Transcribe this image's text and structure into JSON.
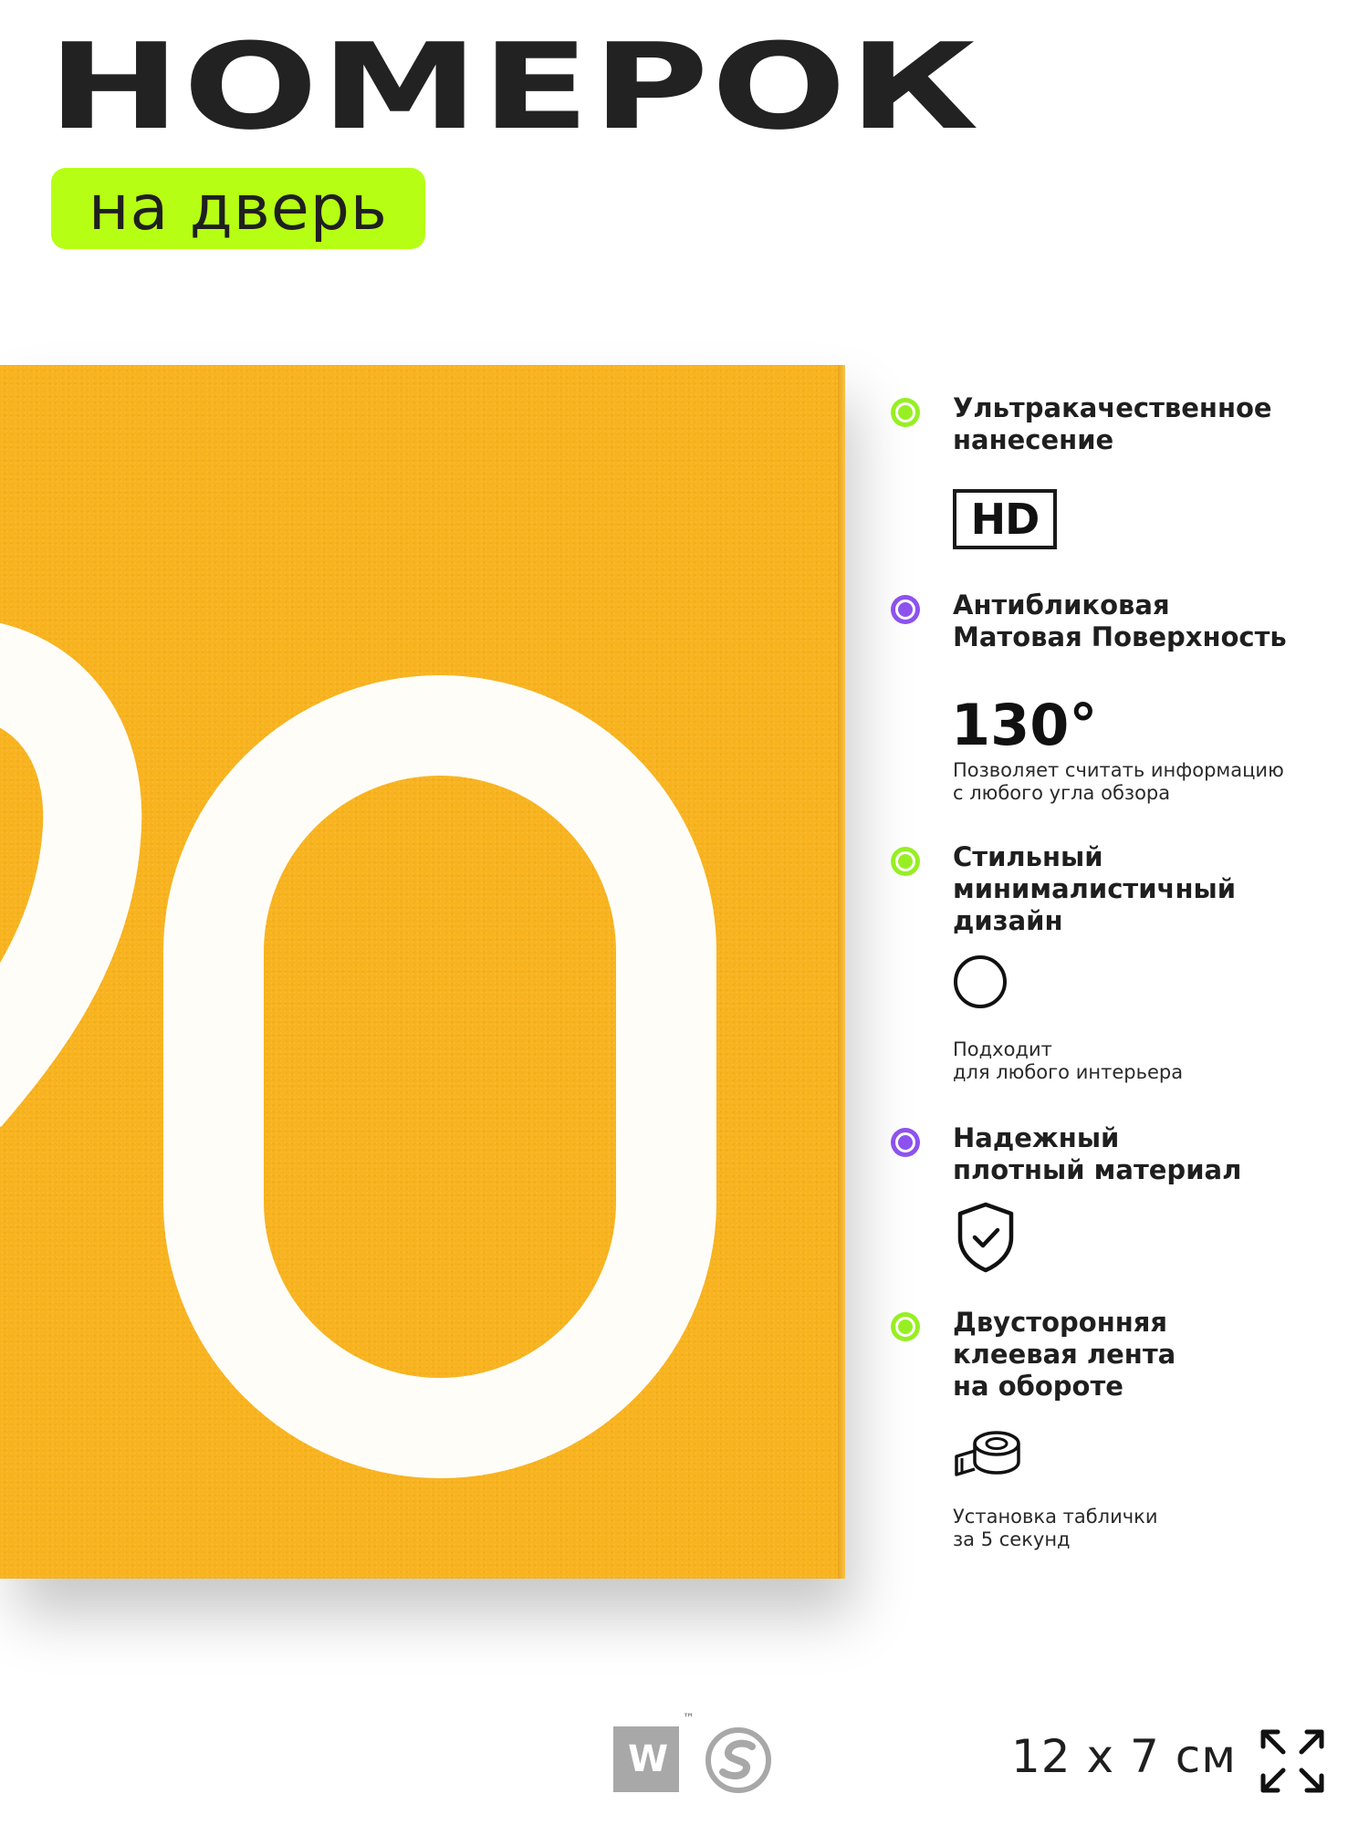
{
  "header": {
    "title": "НОМЕРОК",
    "subtitle": "на дверь"
  },
  "plate": {
    "color": "#f8b31e",
    "digit_color": "#ffffff"
  },
  "features": [
    {
      "dot_color": "#97ef23",
      "title": "Ультракачественное\nнанесение",
      "badge": "HD"
    },
    {
      "dot_color": "#8d52ee",
      "title": "Антибликовая\nМатовая Поверхность",
      "value": "130°",
      "note": "Позволяет считать информацию\nс любого угла обзора"
    },
    {
      "dot_color": "#97ef23",
      "title": "Стильный\nминималистичный\nдизайн",
      "icon": "circle-icon",
      "note": "Подходит\nдля любого интерьера"
    },
    {
      "dot_color": "#8d52ee",
      "title": "Надежный\nплотный материал",
      "icon": "shield-check-icon"
    },
    {
      "dot_color": "#97ef23",
      "title": "Двусторонняя\nклеевая лента\nна обороте",
      "icon": "tape-roll-icon",
      "note": "Установка таблички\nза 5 секунд"
    }
  ],
  "footer": {
    "logo_text": "W",
    "trademark": "™",
    "size": "12 x 7 см",
    "expand_icon": "expand-arrows-icon"
  },
  "colors": {
    "accent_green": "#b6ff14",
    "accent_purple": "#8d52ee",
    "text_dark": "#1f1f1f"
  }
}
